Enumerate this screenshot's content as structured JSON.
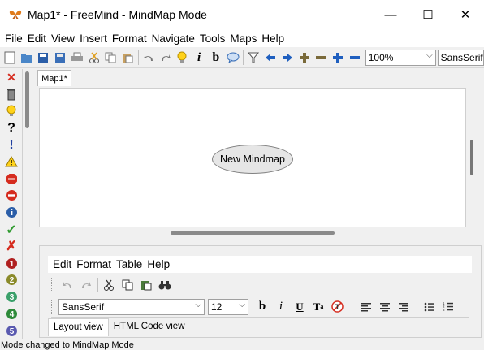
{
  "window": {
    "title": "Map1* - FreeMind - MindMap Mode",
    "minimize_glyph": "—",
    "maximize_glyph": "☐",
    "close_glyph": "✕"
  },
  "menubar": {
    "items": [
      "File",
      "Edit",
      "View",
      "Insert",
      "Format",
      "Navigate",
      "Tools",
      "Maps",
      "Help"
    ]
  },
  "toolbar": {
    "zoom": "100%",
    "font": "SansSerif"
  },
  "tabs": {
    "map_tab": "Map1*"
  },
  "mindmap": {
    "root_node": "New Mindmap"
  },
  "note_editor": {
    "menu_items": [
      "Edit",
      "Format",
      "Table",
      "Help"
    ],
    "font": "SansSerif",
    "font_size": "12",
    "view_tabs": [
      "Layout view",
      "HTML Code view"
    ],
    "active_view": "Layout view"
  },
  "status": {
    "text": "Mode changed to MindMap Mode"
  },
  "colors": {
    "node_fill": "#e6e6e6",
    "canvas_bg": "#ffffff",
    "toolbar_blue": "#1f5fbf",
    "red": "#d52b1e",
    "green": "#2e9a2e"
  }
}
